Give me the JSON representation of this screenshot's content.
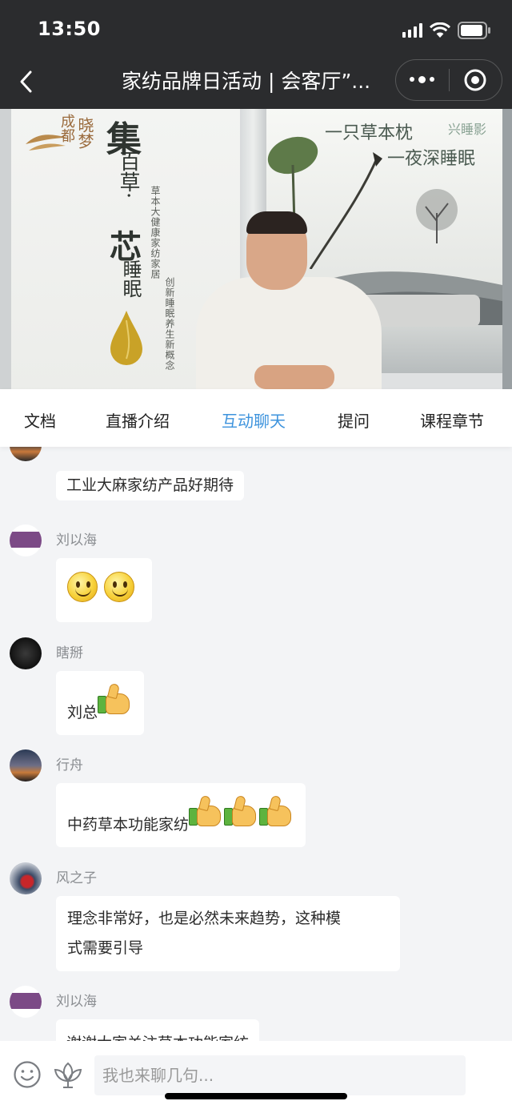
{
  "status_bar": {
    "time": "13:50"
  },
  "nav": {
    "title": "家纺品牌日活动 | 会客厅”...",
    "more_label": "•••"
  },
  "video": {
    "brand_a": "成都",
    "brand_b": "晓梦",
    "headline_1": "集",
    "headline_2": "百草·",
    "headline_3": "芯",
    "headline_4": "睡眠",
    "tagline_1": "草本大健康家纺家居",
    "tagline_2": "创新睡眠养生新概念",
    "slogan_1": "一只草本枕",
    "slogan_2": "一夜深睡眠",
    "watermark": "兴睡影"
  },
  "tabs": [
    {
      "label": "文档"
    },
    {
      "label": "直播介绍"
    },
    {
      "label": "互动聊天",
      "active": true
    },
    {
      "label": "提问"
    },
    {
      "label": "课程章节"
    }
  ],
  "messages": [
    {
      "nick": "",
      "text": "工业大麻家纺产品好期待",
      "emoji": []
    },
    {
      "nick": "刘以海",
      "text": "",
      "emoji": [
        "smile",
        "smile"
      ]
    },
    {
      "nick": "瞎掰",
      "text": "刘总",
      "emoji": [
        "thumbs-up"
      ]
    },
    {
      "nick": "行舟",
      "text": "中药草本功能家纺",
      "emoji": [
        "thumbs-up",
        "thumbs-up",
        "thumbs-up"
      ]
    },
    {
      "nick": "风之子",
      "text_line1": "理念非常好，也是必然未来趋势，这种模",
      "text_line2": "式需要引导"
    },
    {
      "nick": "刘以海",
      "text": "谢谢大家关注草本功能家纺"
    }
  ],
  "input": {
    "placeholder": "我也来聊几句..."
  },
  "colors": {
    "accent": "#3d93dd",
    "header_bg": "#2b2c2e"
  }
}
